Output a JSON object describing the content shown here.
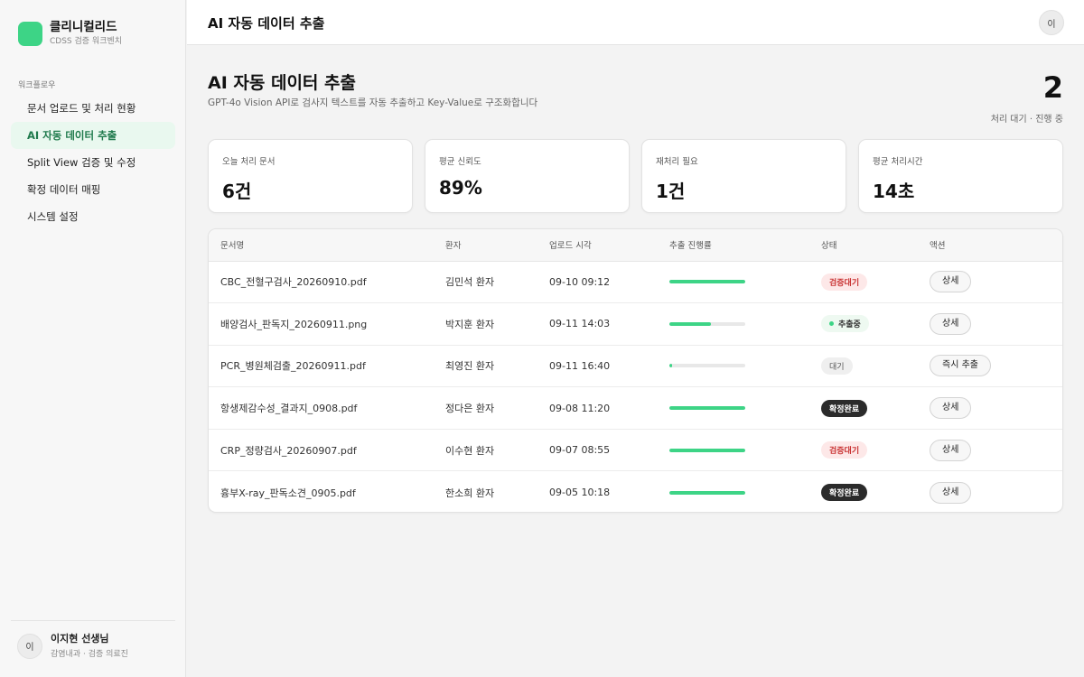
{
  "sidebar": {
    "brand_name": "클리니컬리드",
    "brand_sub": "CDSS 검증 워크벤치",
    "section_label": "워크플로우",
    "items": [
      {
        "label": "문서 업로드 및 처리 현황"
      },
      {
        "label": "AI 자동 데이터 추출"
      },
      {
        "label": "Split View 검증 및 수정"
      },
      {
        "label": "확정 데이터 매핑"
      },
      {
        "label": "시스템 설정"
      }
    ],
    "user": {
      "initial": "이",
      "name": "이지현 선생님",
      "role": "감염내과 · 검증 의료진"
    }
  },
  "header": {
    "title": "AI 자동 데이터 추출",
    "avatar_initial": "이"
  },
  "page": {
    "title": "AI 자동 데이터 추출",
    "description": "GPT-4o Vision API로 검사지 텍스트를 자동 추출하고 Key-Value로 구조화합니다",
    "pending_count": "2",
    "pending_label": "처리 대기 · 진행 중"
  },
  "stats": [
    {
      "label": "오늘 처리 문서",
      "value": "6건"
    },
    {
      "label": "평균 신뢰도",
      "value": "89%"
    },
    {
      "label": "재처리 필요",
      "value": "1건"
    },
    {
      "label": "평균 처리시간",
      "value": "14초"
    }
  ],
  "table": {
    "columns": [
      "문서명",
      "환자",
      "업로드 시각",
      "추출 진행률",
      "상태",
      "액션"
    ],
    "rows": [
      {
        "doc": "CBC_전혈구검사_20260910.pdf",
        "patient": "김민석 환자",
        "uploaded": "09-10 09:12",
        "progress": 1.0,
        "status": "검증대기",
        "status_type": "pending-review",
        "action": "상세"
      },
      {
        "doc": "배양검사_판독지_20260911.png",
        "patient": "박지훈 환자",
        "uploaded": "09-11 14:03",
        "progress": 0.55,
        "status": "추출중",
        "status_type": "extracting",
        "action": "상세"
      },
      {
        "doc": "PCR_병원체검출_20260911.pdf",
        "patient": "최영진 환자",
        "uploaded": "09-11 16:40",
        "progress": 0.04,
        "status": "대기",
        "status_type": "waiting",
        "action": "즉시 추출"
      },
      {
        "doc": "항생제감수성_결과지_0908.pdf",
        "patient": "정다은 환자",
        "uploaded": "09-08 11:20",
        "progress": 1.0,
        "status": "확정완료",
        "status_type": "confirmed",
        "action": "상세"
      },
      {
        "doc": "CRP_정량검사_20260907.pdf",
        "patient": "이수현 환자",
        "uploaded": "09-07 08:55",
        "progress": 1.0,
        "status": "검증대기",
        "status_type": "pending-review",
        "action": "상세"
      },
      {
        "doc": "흉부X-ray_판독소견_0905.pdf",
        "patient": "한소희 환자",
        "uploaded": "09-05 10:18",
        "progress": 1.0,
        "status": "확정완료",
        "status_type": "confirmed",
        "action": "상세"
      }
    ]
  },
  "colors": {
    "accent": "#3dd486",
    "active_nav_bg": "#e9f8ef",
    "active_nav_text": "#1f7a4c",
    "badge_red_bg": "#fde8e8",
    "badge_red_text": "#c93434",
    "badge_dark": "#2b2b2b"
  }
}
